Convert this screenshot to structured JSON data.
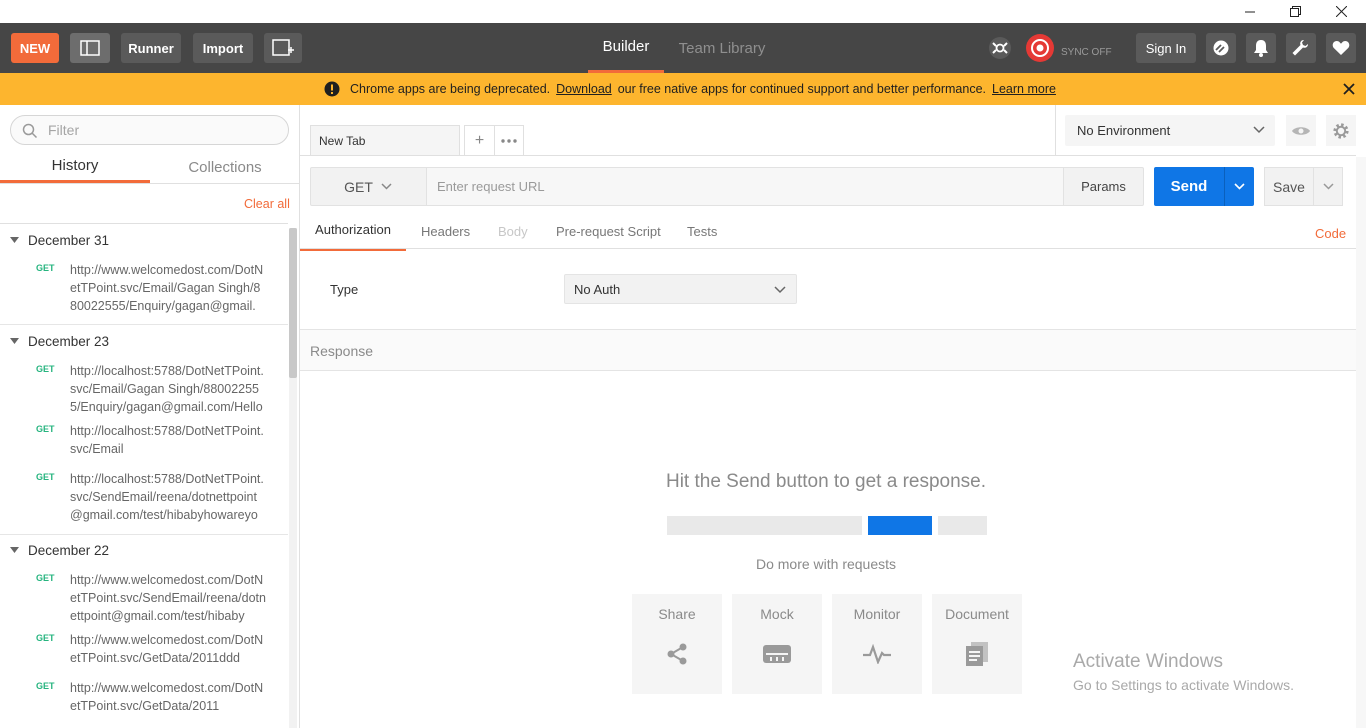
{
  "window": {
    "minimize_icon": "minimize-icon",
    "restore_icon": "restore-icon",
    "close_icon": "close-icon"
  },
  "header": {
    "new_label": "NEW",
    "runner_label": "Runner",
    "import_label": "Import",
    "tabs": [
      {
        "label": "Builder",
        "active": true
      },
      {
        "label": "Team Library",
        "active": false
      }
    ],
    "sync_label": "SYNC OFF",
    "signin_label": "Sign In",
    "accent": "#f26b3a"
  },
  "banner": {
    "text_before": "Chrome apps are being deprecated.",
    "link_download": "Download",
    "text_after": "our free native apps for continued support and better performance.",
    "link_learn": "Learn more",
    "color": "#fdb52e"
  },
  "sidebar": {
    "filter_placeholder": "Filter",
    "tabs": [
      {
        "label": "History",
        "active": true
      },
      {
        "label": "Collections",
        "active": false
      }
    ],
    "clear_all": "Clear all",
    "groups": [
      {
        "date": "December 31",
        "items": [
          {
            "method": "GET",
            "url": "http://www.welcomedost.com/DotNetTPoint.svc/Email/Gagan Singh/880022555/Enquiry/gagan@gmail."
          }
        ]
      },
      {
        "date": "December 23",
        "items": [
          {
            "method": "GET",
            "url": "http://localhost:5788/DotNetTPoint.svc/Email/Gagan Singh/880022555/Enquiry/gagan@gmail.com/Hello"
          },
          {
            "method": "GET",
            "url": "http://localhost:5788/DotNetTPoint.svc/Email"
          },
          {
            "method": "GET",
            "url": "http://localhost:5788/DotNetTPoint.svc/SendEmail/reena/dotnettpoint@gmail.com/test/hibabyhowareyo"
          }
        ]
      },
      {
        "date": "December 22",
        "items": [
          {
            "method": "GET",
            "url": "http://www.welcomedost.com/DotNetTPoint.svc/SendEmail/reena/dotnettpoint@gmail.com/test/hibaby"
          },
          {
            "method": "GET",
            "url": "http://www.welcomedost.com/DotNetTPoint.svc/GetData/2011ddd"
          },
          {
            "method": "GET",
            "url": "http://www.welcomedost.com/DotNetTPoint.svc/GetData/2011"
          }
        ]
      }
    ]
  },
  "request": {
    "tab_label": "New Tab",
    "environment": "No Environment",
    "method": "GET",
    "url_placeholder": "Enter request URL",
    "params_label": "Params",
    "send_label": "Send",
    "save_label": "Save",
    "send_color": "#0f76e6",
    "tabs": [
      {
        "label": "Authorization",
        "active": true
      },
      {
        "label": "Headers",
        "active": false
      },
      {
        "label": "Body",
        "active": false,
        "disabled": true
      },
      {
        "label": "Pre-request Script",
        "active": false
      },
      {
        "label": "Tests",
        "active": false
      }
    ],
    "code_label": "Code",
    "type_label": "Type",
    "auth_value": "No Auth"
  },
  "response": {
    "heading": "Response",
    "hint": "Hit the Send button to get a response.",
    "more": "Do more with requests",
    "cards": [
      {
        "label": "Share",
        "icon": "share-icon"
      },
      {
        "label": "Mock",
        "icon": "mock-icon"
      },
      {
        "label": "Monitor",
        "icon": "monitor-icon"
      },
      {
        "label": "Document",
        "icon": "document-icon"
      }
    ]
  },
  "watermark": {
    "title": "Activate Windows",
    "subtitle": "Go to Settings to activate Windows."
  }
}
